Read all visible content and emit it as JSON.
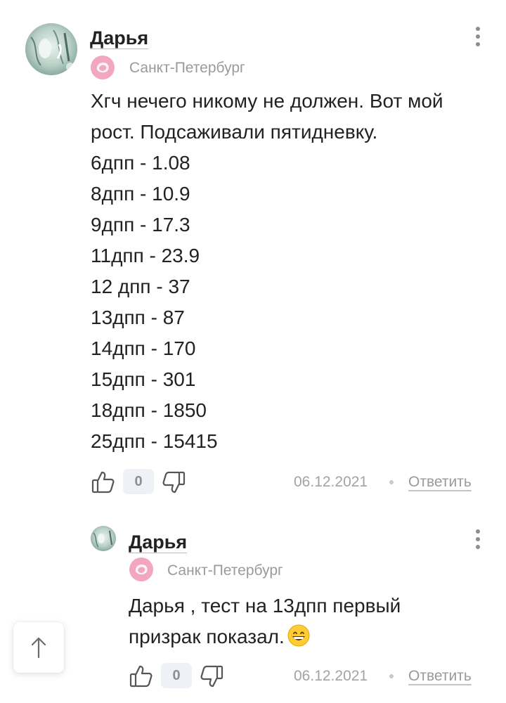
{
  "colors": {
    "text": "#222222",
    "muted": "#9a9a9a",
    "counter_bg": "#eef2f6",
    "geo_pink": "#f2a7bf"
  },
  "comments": [
    {
      "author": "Дарья",
      "location": "Санкт-Петербург",
      "lines": [
        "Хгч нечего никому не должен. Вот мой",
        "рост. Подсаживали пятидневку.",
        "6дпп - 1.08",
        "8дпп - 10.9",
        "9дпп - 17.3",
        "11дпп - 23.9",
        "12 дпп - 37",
        "13дпп - 87",
        "14дпп - 170",
        "15дпп - 301",
        "18дпп - 1850",
        "25дпп - 15415"
      ],
      "likes": "0",
      "date": "06.12.2021",
      "reply_label": "Ответить",
      "icons": {
        "avatar": "avatar",
        "geo": "pink-blob-icon",
        "more": "more-vertical-icon",
        "like": "thumbs-up-icon",
        "dislike": "thumbs-down-icon"
      }
    },
    {
      "author": "Дарья",
      "location": "Санкт-Петербург",
      "lines": [
        "Дарья , тест на 13дпп первый",
        "призрак показал."
      ],
      "emoji": "grinning-face-emoji",
      "likes": "0",
      "date": "06.12.2021",
      "reply_label": "Ответить",
      "icons": {
        "avatar": "avatar",
        "geo": "pink-blob-icon",
        "more": "more-vertical-icon",
        "like": "thumbs-up-icon",
        "dislike": "thumbs-down-icon"
      }
    }
  ],
  "scroll_top": {
    "icon": "arrow-up-icon"
  }
}
